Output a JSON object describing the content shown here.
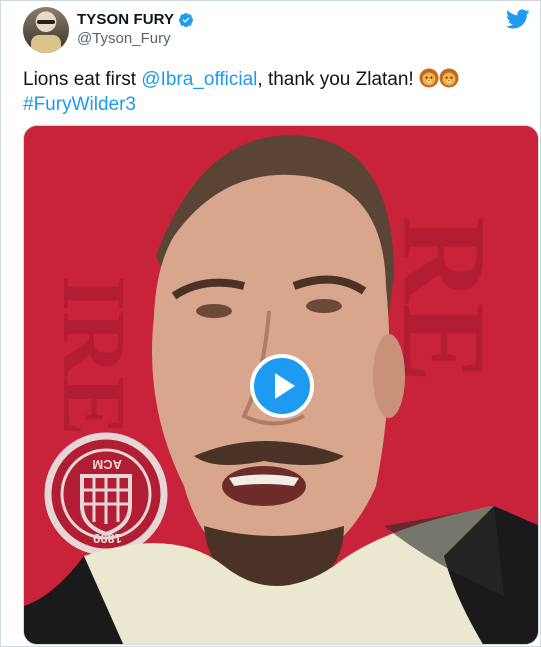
{
  "tweet": {
    "display_name": "TYSON FURY",
    "handle": "@Tyson_Fury",
    "verified": true,
    "text_part1": "Lions eat first ",
    "mention": "@Ibra_official",
    "text_part2": ", thank you Zlatan! ",
    "hashtag": "#FuryWilder3",
    "emoji": "lion-face",
    "emoji_count": 2
  },
  "media": {
    "type": "video",
    "badge_text": "ACM",
    "badge_year": "1899"
  },
  "icons": {
    "brand": "twitter-bird-icon",
    "verified": "verified-badge-icon",
    "play": "play-icon"
  },
  "colors": {
    "accent": "#1d9bf0",
    "text": "#0f1419",
    "secondary": "#536471",
    "video_bg": "#c8233a"
  }
}
